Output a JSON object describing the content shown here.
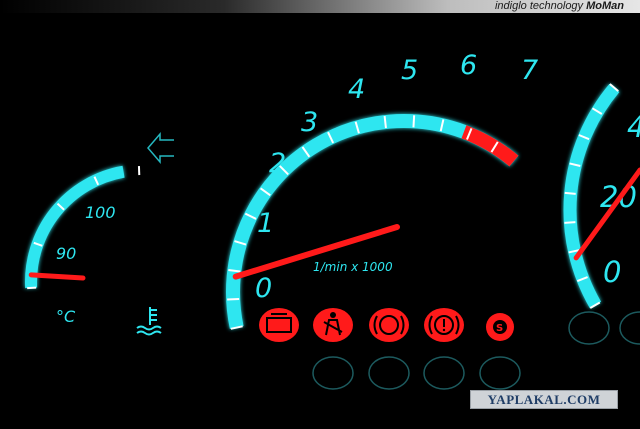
{
  "banner": {
    "text_a": "indiglo technology ",
    "text_b": "MoMan"
  },
  "tachometer": {
    "labels": [
      "0",
      "1",
      "2",
      "3",
      "4",
      "5",
      "6",
      "7"
    ],
    "unit": "1/min x 1000",
    "needle_value": 0.9,
    "redline_from": 6.4
  },
  "temperature": {
    "labels": [
      "90",
      "100"
    ],
    "unit": "°C",
    "needle_value": 0.08
  },
  "speedometer": {
    "labels": [
      "0",
      "20",
      "4"
    ],
    "needle_value": 0.22
  },
  "warning_lights": [
    {
      "name": "engine-warning",
      "color": "#ff1a1a"
    },
    {
      "name": "seatbelt-warning",
      "color": "#ff1a1a"
    },
    {
      "name": "abs-warning",
      "color": "#ff1a1a"
    },
    {
      "name": "brake-warning",
      "color": "#ff1a1a"
    },
    {
      "name": "esp-warning",
      "color": "#ff1a1a"
    }
  ],
  "colors": {
    "accent": "#2ee6f0",
    "red": "#ff1a1a"
  },
  "watermark": "YAPLAKAL.COM"
}
